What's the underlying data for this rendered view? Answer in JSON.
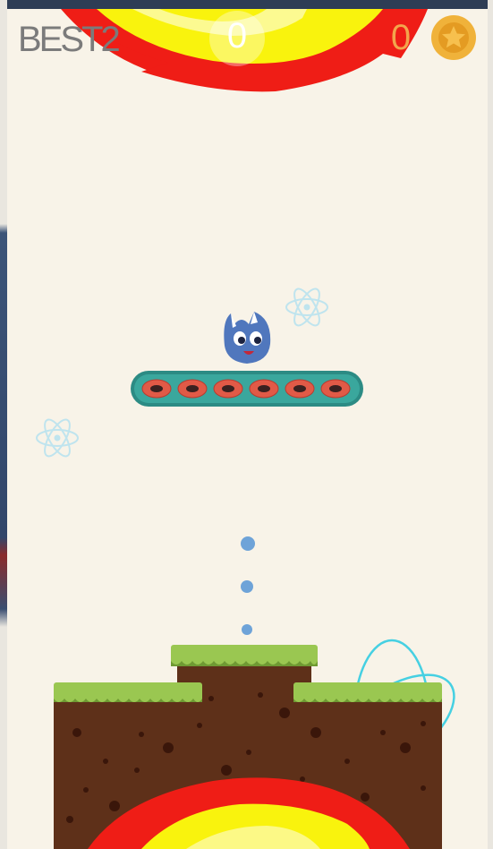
{
  "hud": {
    "best_label": "BEST",
    "best_value": "2",
    "score": "0",
    "coins": "0"
  },
  "icons": {
    "coin": "star-coin-icon",
    "character": "blue-creature-icon",
    "atom": "atom-icon"
  },
  "colors": {
    "background": "#f8f3e8",
    "fire_red": "#ef1d16",
    "fire_yellow": "#f9f30d",
    "platform_teal": "#3aa79d",
    "platform_ring": "#e15a47",
    "grass": "#9ac751",
    "dirt": "#5e3019",
    "trail": "#6ea3d8",
    "coin": "#f0b23a"
  }
}
